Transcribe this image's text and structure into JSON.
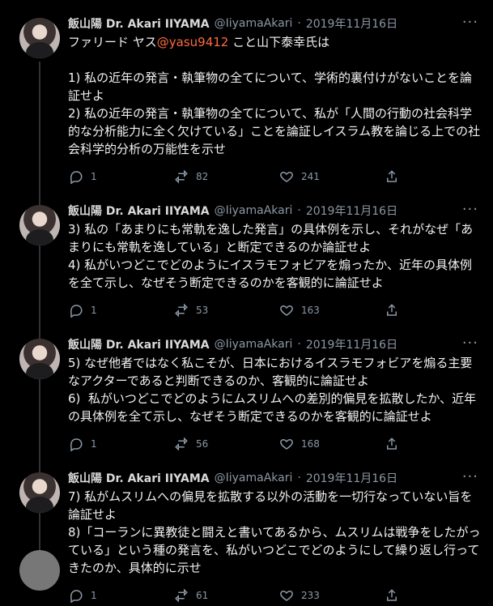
{
  "tweets": [
    {
      "name": "飯山陽 Dr. Akari IIYAMA",
      "handle": "@IiyamaAkari",
      "date": "2019年11月16日",
      "reply_prefix": "ファリード ヤス",
      "mention": "@yasu9412",
      "reply_suffix": " こと山下泰幸氏は",
      "body": "\n\n1) 私の近年の発言・執筆物の全てについて、学術的裏付けがないことを論証せよ\n2) 私の近年の発言・執筆物の全てについて、私が「人間の行動の社会科学的な分析能力に全く欠けている」ことを論証しイスラム教を論じる上での社会科学的分析の万能性を示せ",
      "reply_count": "1",
      "retweet_count": "82",
      "like_count": "241"
    },
    {
      "name": "飯山陽 Dr. Akari IIYAMA",
      "handle": "@IiyamaAkari",
      "date": "2019年11月16日",
      "body": "3) 私の「あまりにも常軌を逸した発言」の具体例を示し、それがなぜ「あまりにも常軌を逸している」と断定できるのか論証せよ\n4) 私がいつどこでどのようにイスラモフォビアを煽ったか、近年の具体例を全て示し、なぜそう断定できるのかを客観的に論証せよ",
      "reply_count": "1",
      "retweet_count": "53",
      "like_count": "163"
    },
    {
      "name": "飯山陽 Dr. Akari IIYAMA",
      "handle": "@IiyamaAkari",
      "date": "2019年11月16日",
      "body": "5) なぜ他者ではなく私こそが、日本におけるイスラモフォビアを煽る主要なアクターであると判断できるのか、客観的に論証せよ\n6)  私がいつどこでどのようにムスリムへの差別的偏見を拡散したか、近年の具体例を全て示し、なぜそう断定できるのかを客観的に論証せよ",
      "reply_count": "1",
      "retweet_count": "56",
      "like_count": "168"
    },
    {
      "name": "飯山陽 Dr. Akari IIYAMA",
      "handle": "@IiyamaAkari",
      "date": "2019年11月16日",
      "body": "7) 私がムスリムへの偏見を拡散する以外の活動を一切行なっていない旨を論証せよ\n8)「コーランに異教徒と闘えと書いてあるから、ムスリムは戦争をしたがっている」という種の発言を、私がいつどこでどのようにして繰り返し行ってきたのか、具体的に示せ",
      "reply_count": "1",
      "retweet_count": "61",
      "like_count": "233"
    }
  ],
  "separator": "·",
  "icons": {
    "more": "more-horizontal-icon",
    "reply": "reply-icon",
    "retweet": "retweet-icon",
    "like": "heart-icon",
    "share": "share-icon"
  },
  "colors": {
    "background": "#000000",
    "text": "#f2f2f2",
    "muted": "#8b98a5",
    "mention": "#ff6b3d"
  }
}
